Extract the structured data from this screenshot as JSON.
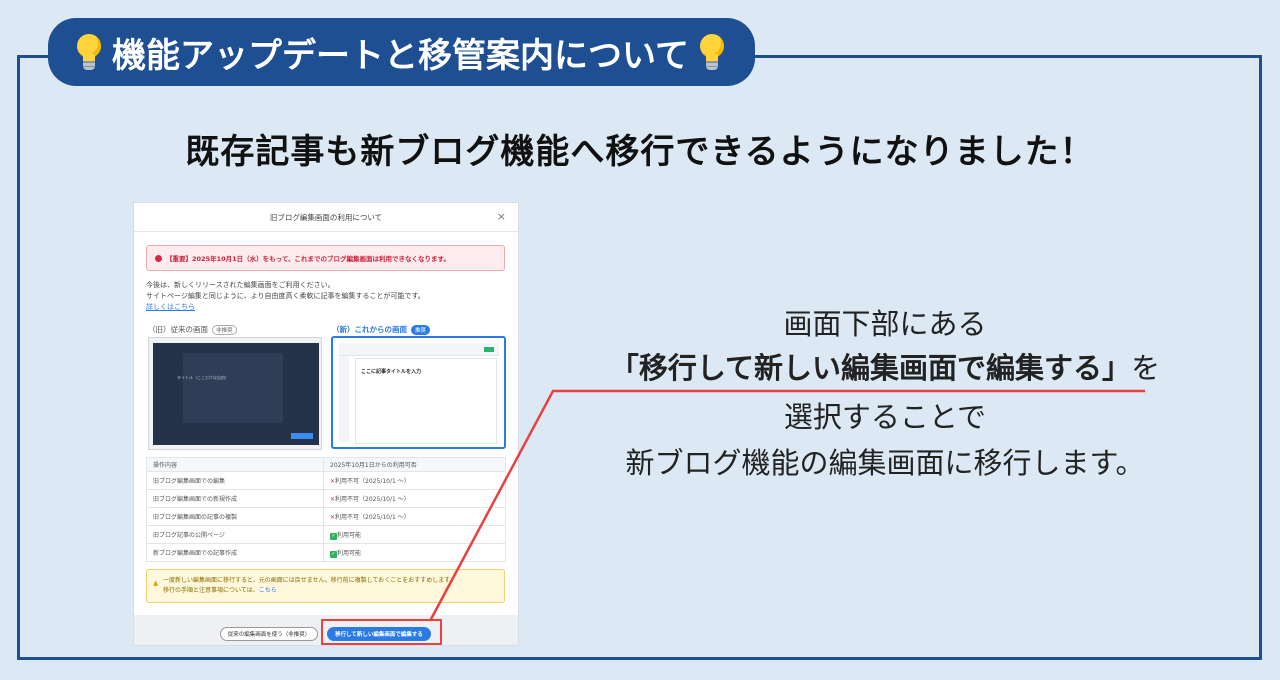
{
  "header": {
    "title": "機能アップデートと移管案内について"
  },
  "main_title": "既存記事も新ブログ機能へ移行できるようになりました！",
  "dialog": {
    "title": "旧ブログ編集画面の利用について",
    "close": "×",
    "alert": "【重要】2025年10月1日（水）をもって、これまでのブログ編集画面は利用できなくなります。",
    "intro_line1": "今後は、新しくリリースされた編集画面をご利用ください。",
    "intro_line2": "サイトページ編集と同じように、より自由度高く柔軟に記事を編集することが可能です。",
    "intro_link": "詳しくはこちら",
    "old_label": "（旧）従来の画面",
    "old_tag": "非推奨",
    "new_label": "（新）これからの画面",
    "new_tag": "推奨",
    "new_screen_title": "ここに記事タイトルを入力",
    "old_screen_text": "タイトル（ここだけは自由）",
    "table": {
      "headers": [
        "操作内容",
        "2025年10月1日からの利用可否"
      ],
      "rows": [
        [
          "旧ブログ編集画面での編集",
          "利用不可（2025/10/1 〜）"
        ],
        [
          "旧ブログ編集画面での新規作成",
          "利用不可（2025/10/1 〜）"
        ],
        [
          "旧ブログ編集画面の記事の複製",
          "利用不可（2025/10/1 〜）"
        ],
        [
          "旧ブログ記事の公開ページ",
          "利用可能"
        ],
        [
          "新ブログ編集画面での記事作成",
          "利用可能"
        ]
      ]
    },
    "warning_line1": "一度新しい編集画面に移行すると、元の画面には戻せません。移行前に複製しておくことをおすすめします。",
    "warning_line2": "移行の手順と注意事項については、",
    "warning_link": "こちら",
    "btn_old": "従来の編集画面を使う（非推奨）",
    "btn_new": "移行して新しい編集画面で編集する"
  },
  "callout": {
    "line1": "画面下部にある",
    "line2_bold": "「移行して新しい編集画面で編集する」",
    "line2_rest": "を",
    "line3": "選択することで",
    "line4": "新ブログ機能の編集画面に移行します。"
  },
  "colors": {
    "navy": "#1e4f93",
    "background": "#dce9f5",
    "accent_red": "#e8413f",
    "link_blue": "#2a7be4"
  }
}
